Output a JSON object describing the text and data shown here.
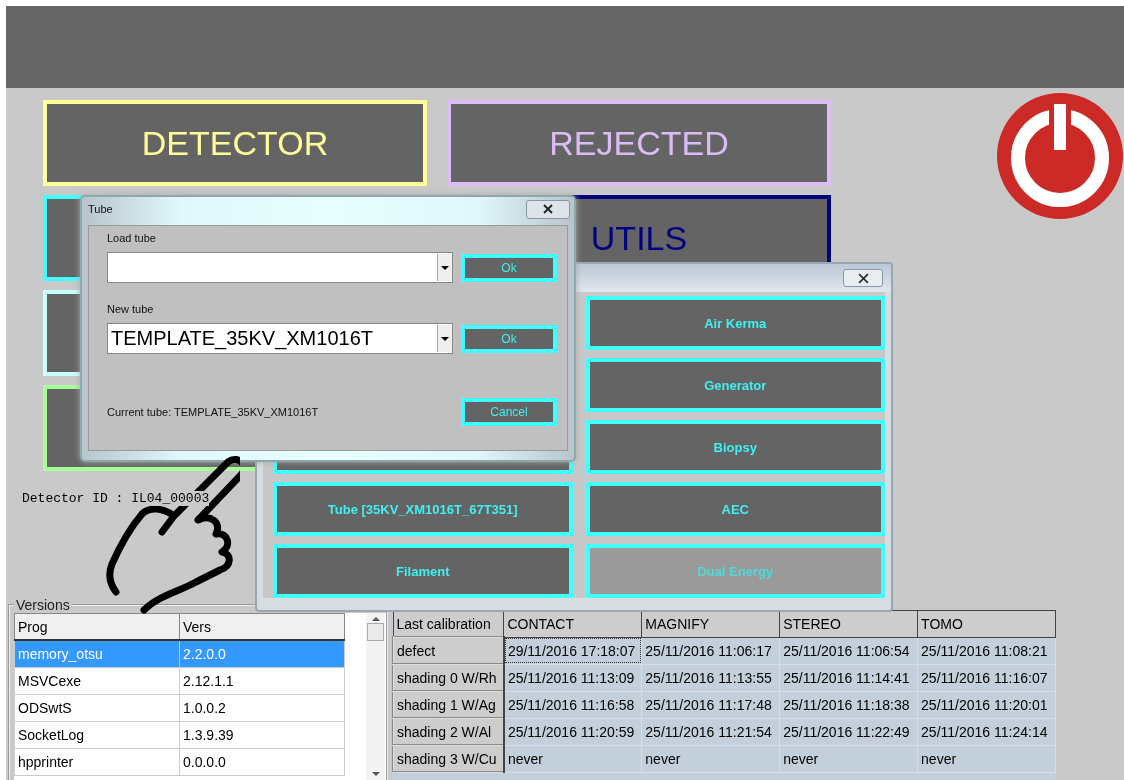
{
  "main_buttons": [
    {
      "label": "DETECTOR",
      "color": "#ffff99"
    },
    {
      "color": "#40ffff"
    },
    {
      "color": "#c8ffff"
    },
    {
      "color": "#a8ff98"
    },
    {
      "label": "REJECTED",
      "color": "#dcbcf4"
    },
    {
      "label": "UTILS",
      "color": "#000080"
    }
  ],
  "detector_id": "Detector ID  : IL04_00003",
  "calibration_dialog": {
    "buttons": [
      {
        "kind": "blank"
      },
      {
        "kind": "labeled",
        "label": "Tube [35KV_XM1016T_67T351]",
        "disabled": false
      },
      {
        "kind": "labeled",
        "label": "Filament",
        "disabled": false
      }
    ],
    "right_buttons": [
      {
        "kind": "labeled",
        "label": "Air Kerma",
        "disabled": false
      },
      {
        "kind": "labeled",
        "label": "Generator",
        "disabled": false
      },
      {
        "kind": "labeled",
        "label": "Biopsy",
        "disabled": false
      },
      {
        "kind": "labeled",
        "label": "AEC",
        "disabled": false
      },
      {
        "kind": "labeled",
        "label": "Dual Energy",
        "disabled": true
      }
    ]
  },
  "tube_dialog": {
    "title": "Tube",
    "load_label": "Load tube",
    "load_ok": "Ok",
    "new_label": "New tube",
    "new_value": "TEMPLATE_35KV_XM1016T",
    "new_ok": "Ok",
    "current": "Current tube: TEMPLATE_35KV_XM1016T",
    "cancel": "Cancel"
  },
  "versions": {
    "title": "Versions",
    "columns": [
      "Prog",
      "Vers"
    ],
    "rows": [
      {
        "cells": [
          "memory_otsu",
          "2.2.0.0"
        ],
        "selected": true
      },
      {
        "cells": [
          "MSVCexe",
          "2.12.1.1"
        ],
        "selected": false
      },
      {
        "cells": [
          "ODSwtS",
          "1.0.0.2"
        ],
        "selected": false
      },
      {
        "cells": [
          "SocketLog",
          "1.3.9.39"
        ],
        "selected": false
      },
      {
        "cells": [
          "hpprinter",
          "0.0.0.0"
        ],
        "selected": false
      }
    ]
  },
  "calibration": {
    "columns": [
      "Last calibration",
      "CONTACT",
      "MAGNIFY",
      "STEREO",
      "TOMO"
    ],
    "rows": [
      {
        "cells": [
          "defect",
          "29/11/2016 17:18:07",
          "25/11/2016 11:06:17",
          "25/11/2016 11:06:54",
          "25/11/2016 11:08:21"
        ]
      },
      {
        "cells": [
          "shading 0 W/Rh",
          "25/11/2016 11:13:09",
          "25/11/2016 11:13:55",
          "25/11/2016 11:14:41",
          "25/11/2016 11:16:07"
        ]
      },
      {
        "cells": [
          "shading 1 W/Ag",
          "25/11/2016 11:16:58",
          "25/11/2016 11:17:48",
          "25/11/2016 11:18:38",
          "25/11/2016 11:20:01"
        ]
      },
      {
        "cells": [
          "shading 2 W/Al",
          "25/11/2016 11:20:59",
          "25/11/2016 11:21:54",
          "25/11/2016 11:22:49",
          "25/11/2016 11:24:14"
        ]
      },
      {
        "cells": [
          "shading 3 W/Cu",
          "never",
          "never",
          "never",
          "never"
        ]
      }
    ]
  }
}
